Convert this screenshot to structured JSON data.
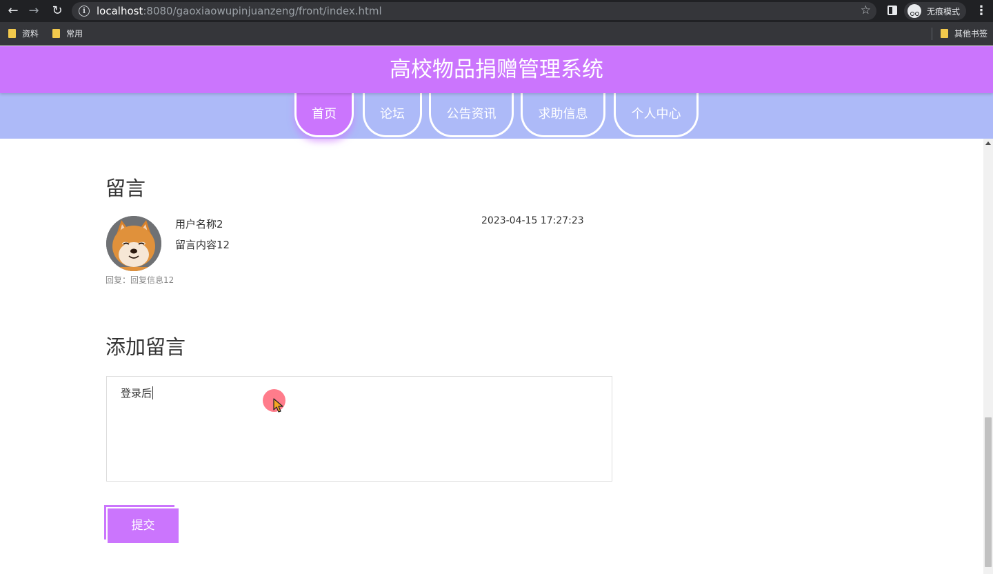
{
  "browser": {
    "url_host": "localhost",
    "url_rest": ":8080/gaoxiaowupinjuanzeng/front/index.html",
    "incognito_label": "无痕模式",
    "bookmarks": [
      {
        "label": "资料"
      },
      {
        "label": "常用"
      }
    ],
    "other_bookmarks": "其他书签"
  },
  "site": {
    "title": "高校物品捐赠管理系统",
    "nav": [
      {
        "label": "首页",
        "active": true
      },
      {
        "label": "论坛"
      },
      {
        "label": "公告资讯"
      },
      {
        "label": "求助信息"
      },
      {
        "label": "个人中心"
      }
    ]
  },
  "messages": {
    "heading": "留言",
    "items": [
      {
        "username": "用户名称2",
        "content": "留言内容12",
        "timestamp": "2023-04-15 17:27:23",
        "reply": "回复：回复信息12"
      }
    ]
  },
  "add_message": {
    "heading": "添加留言",
    "input_value": "登录后",
    "submit_label": "提交"
  },
  "colors": {
    "header_bg": "#cb75fd",
    "nav_bg": "#adbaf8",
    "button_bg": "#cb75fd"
  }
}
